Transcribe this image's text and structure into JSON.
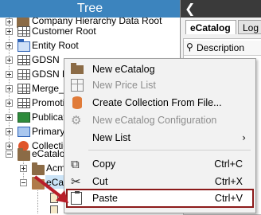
{
  "tree": {
    "title": "Tree",
    "items": [
      {
        "label": "Company Hierarchy Data Root",
        "icon": "folder-icon"
      },
      {
        "label": "Customer Root",
        "icon": "grid-icon"
      },
      {
        "label": "Entity Root",
        "icon": "entity-icon"
      },
      {
        "label": "GDSN",
        "icon": "grid-icon"
      },
      {
        "label": "GDSN Re",
        "icon": "grid-icon"
      },
      {
        "label": "Merge_G",
        "icon": "grid-icon"
      },
      {
        "label": "Promotio",
        "icon": "grid-icon"
      },
      {
        "label": "Publicatio",
        "icon": "publication-icon"
      },
      {
        "label": "Primary",
        "icon": "primary-icon"
      },
      {
        "label": "Collection",
        "icon": "collection-icon"
      },
      {
        "label": "eCatalog",
        "icon": "folder-icon"
      },
      {
        "label": "Acme",
        "icon": "folder-icon"
      },
      {
        "label": "eCata",
        "icon": "folder-icon"
      }
    ]
  },
  "right_panel": {
    "collapse_glyph": "❮",
    "tabs": [
      {
        "label": "eCatalog",
        "active": true
      },
      {
        "label": "Log",
        "active": false
      }
    ],
    "property_header": "Description",
    "partial_text": "N"
  },
  "context_menu": {
    "items": [
      {
        "label": "New eCatalog",
        "shortcut": "",
        "disabled": false,
        "icon": "folder-icon"
      },
      {
        "label": "New Price List",
        "shortcut": "",
        "disabled": true,
        "icon": "price-list-icon"
      },
      {
        "label": "Create Collection From File...",
        "shortcut": "",
        "disabled": false,
        "icon": "collection-cylinder-icon"
      },
      {
        "label": "New eCatalog Configuration",
        "shortcut": "",
        "disabled": true,
        "icon": "gear-icon"
      },
      {
        "label": "New List",
        "shortcut": "",
        "disabled": false,
        "icon": "",
        "submenu": true
      },
      {
        "label": "Copy",
        "shortcut": "Ctrl+C",
        "disabled": false,
        "icon": "copy-icon"
      },
      {
        "label": "Cut",
        "shortcut": "Ctrl+X",
        "disabled": false,
        "icon": "scissors-icon"
      },
      {
        "label": "Paste",
        "shortcut": "Ctrl+V",
        "disabled": false,
        "icon": "clipboard-icon",
        "highlighted": true
      }
    ],
    "submenu_glyph": "›",
    "highlight_color": "#8c1a1a"
  },
  "colors": {
    "tree_header": "#3c84be",
    "right_header": "#3a3a3a",
    "arrow": "#b81e2a"
  }
}
